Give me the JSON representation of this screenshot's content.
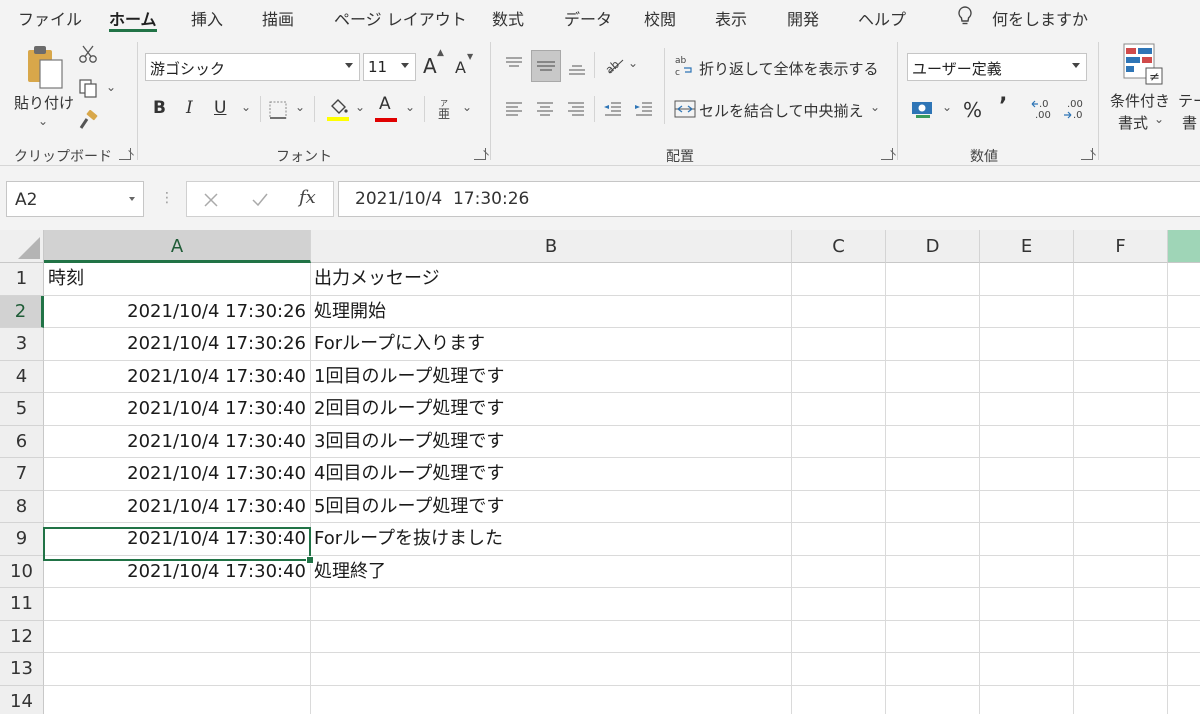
{
  "tabs": [
    {
      "label": "ファイル",
      "active": false
    },
    {
      "label": "ホーム",
      "active": true
    },
    {
      "label": "挿入",
      "active": false
    },
    {
      "label": "描画",
      "active": false
    },
    {
      "label": "ページ レイアウト",
      "active": false
    },
    {
      "label": "数式",
      "active": false
    },
    {
      "label": "データ",
      "active": false
    },
    {
      "label": "校閲",
      "active": false
    },
    {
      "label": "表示",
      "active": false
    },
    {
      "label": "開発",
      "active": false
    },
    {
      "label": "ヘルプ",
      "active": false
    }
  ],
  "tell_me": "何をしますか",
  "ribbon": {
    "clipboard": {
      "paste_label": "貼り付け",
      "group_label": "クリップボード"
    },
    "font": {
      "font_name": "游ゴシック",
      "font_size": "11",
      "group_label": "フォント",
      "bold": "B",
      "italic": "I",
      "underline": "U",
      "grow": "A",
      "shrink": "A",
      "font_color_letter": "A",
      "highlight_color": "#FFFF00",
      "font_color": "#E00000"
    },
    "alignment": {
      "wrap_text": "折り返して全体を表示する",
      "merge_center": "セルを結合して中央揃え",
      "group_label": "配置",
      "abc_icon": "ab\nc"
    },
    "number": {
      "format": "ユーザー定義",
      "percent": "%",
      "comma": "’",
      "inc_decimal": "←.0\n.00",
      "dec_decimal": ".00\n→.0",
      "group_label": "数値"
    },
    "styles": {
      "conditional_line1": "条件付き",
      "conditional_line2": "書式",
      "table_line1": "テー",
      "table_line2": "書"
    }
  },
  "formula_bar": {
    "name_box": "A2",
    "formula": "2021/10/4  17:30:26",
    "fx": "fx"
  },
  "grid": {
    "columns": [
      "A",
      "B",
      "C",
      "D",
      "E",
      "F"
    ],
    "row_numbers": [
      "1",
      "2",
      "3",
      "4",
      "5",
      "6",
      "7",
      "8",
      "9",
      "10",
      "11",
      "12",
      "13",
      "14"
    ],
    "selected_cell": "A2",
    "rows": [
      {
        "a": "時刻",
        "b": "出力メッセージ"
      },
      {
        "a": "2021/10/4 17:30:26",
        "b": "処理開始"
      },
      {
        "a": "2021/10/4 17:30:26",
        "b": "Forループに入ります"
      },
      {
        "a": "2021/10/4 17:30:40",
        "b": "1回目のループ処理です"
      },
      {
        "a": "2021/10/4 17:30:40",
        "b": "2回目のループ処理です"
      },
      {
        "a": "2021/10/4 17:30:40",
        "b": "3回目のループ処理です"
      },
      {
        "a": "2021/10/4 17:30:40",
        "b": "4回目のループ処理です"
      },
      {
        "a": "2021/10/4 17:30:40",
        "b": "5回目のループ処理です"
      },
      {
        "a": "2021/10/4 17:30:40",
        "b": "Forループを抜けました"
      },
      {
        "a": "2021/10/4 17:30:40",
        "b": "処理終了"
      }
    ]
  },
  "colors": {
    "accent": "#217346"
  }
}
